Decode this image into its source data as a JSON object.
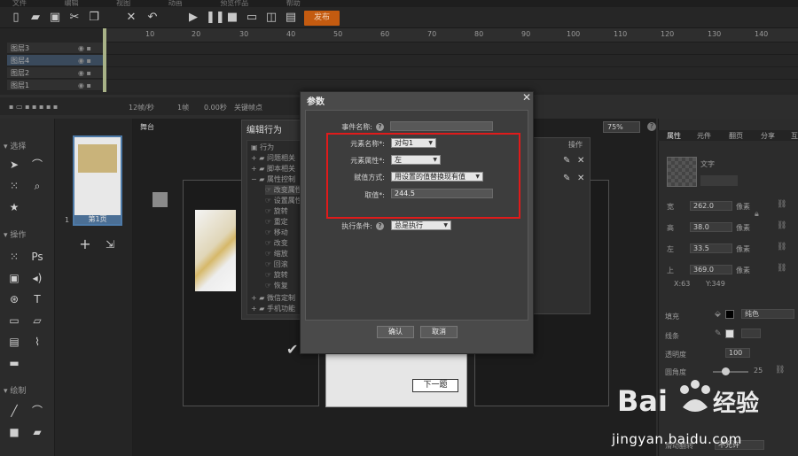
{
  "menu": [
    "文件",
    "编辑",
    "视图",
    "动画",
    "预览作品",
    "帮助"
  ],
  "toolbar": {
    "icons": [
      "new-file-icon",
      "open-folder-icon",
      "save-icon",
      "cut-icon",
      "copy-icon",
      "close-x-icon",
      "undo-icon",
      "play-icon",
      "pause-icon",
      "stop-icon",
      "preview-icon",
      "export-icon",
      "settings-icon"
    ],
    "publish_label": "发布"
  },
  "timeline": {
    "ticks": [
      "10",
      "20",
      "30",
      "40",
      "50",
      "60",
      "70",
      "80",
      "90",
      "100",
      "110",
      "120",
      "130",
      "140"
    ],
    "layers": [
      {
        "name": "图层3",
        "selected": false
      },
      {
        "name": "图层4",
        "selected": true
      },
      {
        "name": "图层2",
        "selected": false
      },
      {
        "name": "图层1",
        "selected": false
      }
    ]
  },
  "status": {
    "fps": "12帧/秒",
    "frame": "1帧",
    "time": "0.00秒",
    "keyframe": "关键帧点"
  },
  "tools_panel": {
    "section_select": "选择",
    "section_ops": "操作",
    "section_draw": "绘制"
  },
  "pages": {
    "thumb_label": "第1页",
    "thumb_index": "1"
  },
  "stage": {
    "tab": "舞台",
    "next_button": "下一题"
  },
  "behavior": {
    "title": "编辑行为",
    "tree": [
      "行为",
      "问题相关",
      "脚本相关",
      "属性控制",
      "改变属性",
      "设置属性",
      "旋转",
      "重定",
      "移动",
      "改变",
      "缩放",
      "回滚",
      "旋转",
      "恢复",
      "微信定制",
      "手机功能"
    ],
    "right_header": "操作",
    "zoom": "75%"
  },
  "properties": {
    "tabs": [
      "属性",
      "元件",
      "翻页",
      "分享",
      "互"
    ],
    "preview_label": "文字",
    "fields": [
      {
        "label": "宽",
        "value": "262.0",
        "unit": "像素"
      },
      {
        "label": "高",
        "value": "38.0",
        "unit": "像素"
      },
      {
        "label": "左",
        "value": "33.5",
        "unit": "像素"
      },
      {
        "label": "上",
        "value": "369.0",
        "unit": "像素"
      }
    ],
    "coords": {
      "x": "X:63",
      "y": "Y:349"
    },
    "fill_label": "填充",
    "fill_value": "纯色",
    "border_label": "线条",
    "opacity_label": "透明度",
    "opacity_value": "100",
    "rounded_label": "圆角度",
    "rounded_value": "25",
    "bottom_label": "滑动翻转",
    "bottom_value": "不允许"
  },
  "dialog": {
    "title": "参数",
    "fields": [
      {
        "label": "事件名称:",
        "value": "",
        "type": "input"
      },
      {
        "label": "元素名称*:",
        "value": "对勾1",
        "type": "select"
      },
      {
        "label": "元素属性*:",
        "value": "左",
        "type": "select"
      },
      {
        "label": "赋值方式:",
        "value": "用设置的值替换现有值",
        "type": "select"
      },
      {
        "label": "取值*:",
        "value": "244.5",
        "type": "input"
      },
      {
        "label": "执行条件:",
        "value": "总是执行",
        "type": "select"
      }
    ],
    "ok": "确认",
    "cancel": "取消",
    "highlight_color": "#e01b1b"
  },
  "watermark": {
    "site": "jingyan.baidu.com",
    "brand": "Baidu 经验"
  }
}
